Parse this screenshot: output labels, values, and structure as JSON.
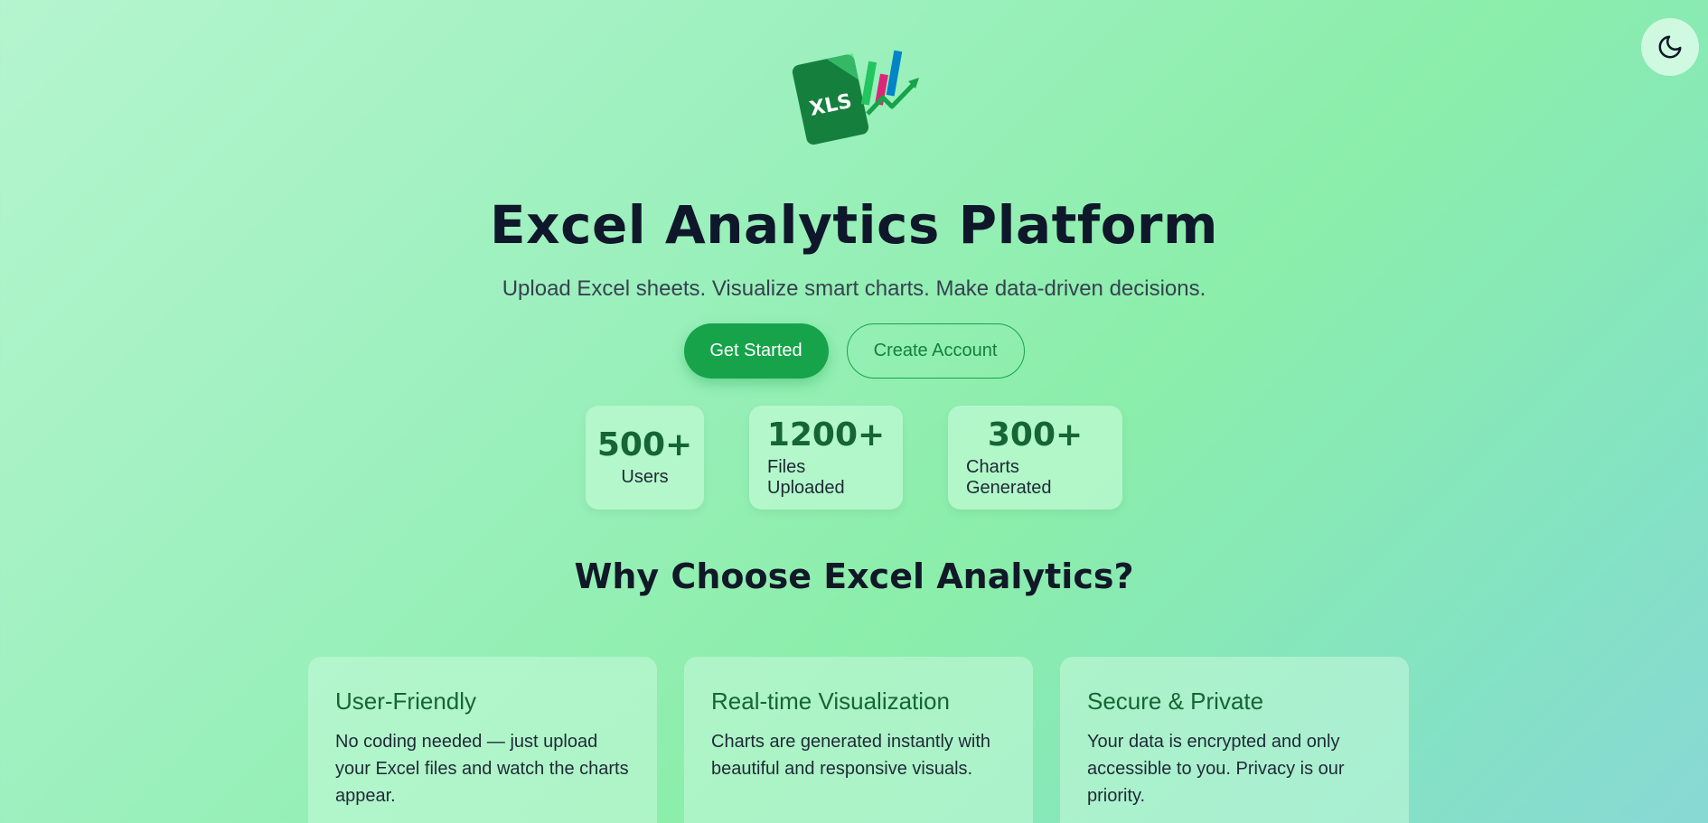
{
  "logo": {
    "badge_text": "XLS"
  },
  "theme_toggle": {
    "icon": "moon-icon"
  },
  "hero": {
    "title": "Excel Analytics Platform",
    "subtitle": "Upload Excel sheets. Visualize smart charts. Make data-driven decisions.",
    "primary_button": "Get Started",
    "secondary_button": "Create Account"
  },
  "stats": [
    {
      "value": "500+",
      "label": "Users"
    },
    {
      "value": "1200+",
      "label": "Files Uploaded"
    },
    {
      "value": "300+",
      "label": "Charts Generated"
    }
  ],
  "features_section": {
    "title": "Why Choose Excel Analytics?",
    "cards": [
      {
        "title": "User-Friendly",
        "text": "No coding needed — just upload your Excel files and watch the charts appear."
      },
      {
        "title": "Real-time Visualization",
        "text": "Charts are generated instantly with beautiful and responsive visuals."
      },
      {
        "title": "Secure & Private",
        "text": "Your data is encrypted and only accessible to you. Privacy is our priority."
      }
    ]
  },
  "colors": {
    "brand_green": "#16a34a",
    "dark_green": "#166534",
    "chart_pink": "#db2777",
    "chart_blue": "#0284c7"
  }
}
